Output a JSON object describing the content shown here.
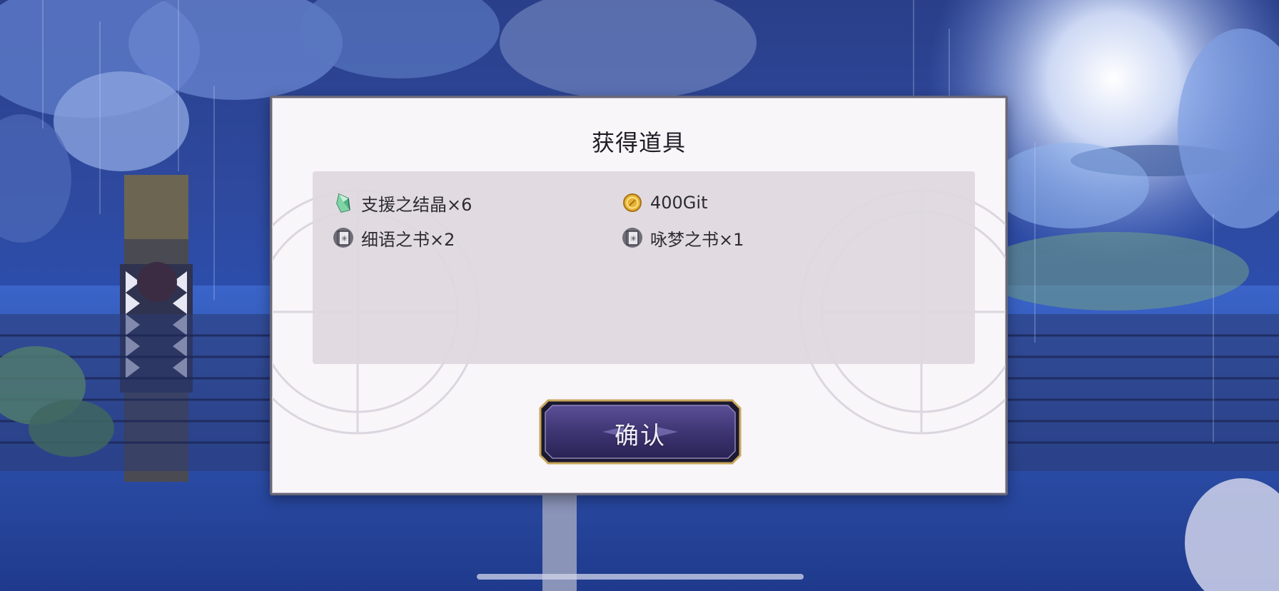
{
  "dialog": {
    "title": "获得道具",
    "items": [
      {
        "icon": "crystal-icon",
        "label": "支援之结晶×6"
      },
      {
        "icon": "gold-coin-icon",
        "label": "400Git"
      },
      {
        "icon": "book-icon",
        "label": "细语之书×2"
      },
      {
        "icon": "book-icon",
        "label": "咏梦之书×1"
      }
    ],
    "confirm_label": "确认"
  },
  "colors": {
    "dialog_bg": "#f8f6f9",
    "panel_bg": "#ded8de",
    "button_bg": "#3e3573",
    "button_border": "#c9a75a",
    "background": "#2b4fb0"
  }
}
